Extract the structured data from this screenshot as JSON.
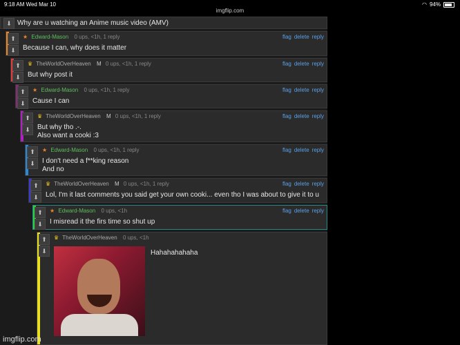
{
  "status": {
    "time": "9:18 AM  Wed Mar 10",
    "url": "imgflip.com",
    "battery": "94%"
  },
  "top_comment": "Why are u watching an Anime music video (AMV)",
  "comments": [
    {
      "user": "Edward-Mason",
      "mod": "",
      "meta": "0 ups, <1h, 1 reply",
      "text": "Because I can, why does it matter",
      "color": "#e8862a"
    },
    {
      "user": "TheWorldOverHeaven",
      "mod": "M",
      "meta": "0 ups, <1h, 1 reply",
      "text": "But why post it",
      "color": "#e03a3a"
    },
    {
      "user": "Edward-Mason",
      "mod": "",
      "meta": "0 ups, <1h, 1 reply",
      "text": "Cause I can",
      "color": "#8a2a7a"
    },
    {
      "user": "TheWorldOverHeaven",
      "mod": "M",
      "meta": "0 ups, <1h, 1 reply",
      "text": "But why tho .-.\nAlso want a cooki :3",
      "color": "#b020c0"
    },
    {
      "user": "Edward-Mason",
      "mod": "",
      "meta": "0 ups, <1h, 1 reply",
      "text": "I don't need a f**king reason\nAnd no",
      "color": "#2a8ad8"
    },
    {
      "user": "TheWorldOverHeaven",
      "mod": "M",
      "meta": "0 ups, <1h, 1 reply",
      "text": "Lol, I'm it last comments you said get your own cooki... even tho I was about to give it to u",
      "color": "#3a3ad0"
    },
    {
      "user": "Edward-Mason",
      "mod": "",
      "meta": "0 ups, <1h",
      "text": "I misread it the firs time so shut up",
      "color": "#2ad040"
    },
    {
      "user": "TheWorldOverHeaven",
      "mod": "",
      "meta": "0 ups, <1h",
      "text": "Hahahahahaha",
      "color": "#e8e020"
    }
  ],
  "actions": {
    "flag": "flag",
    "delete": "delete",
    "reply": "reply"
  },
  "watermark": "imgflip.com"
}
